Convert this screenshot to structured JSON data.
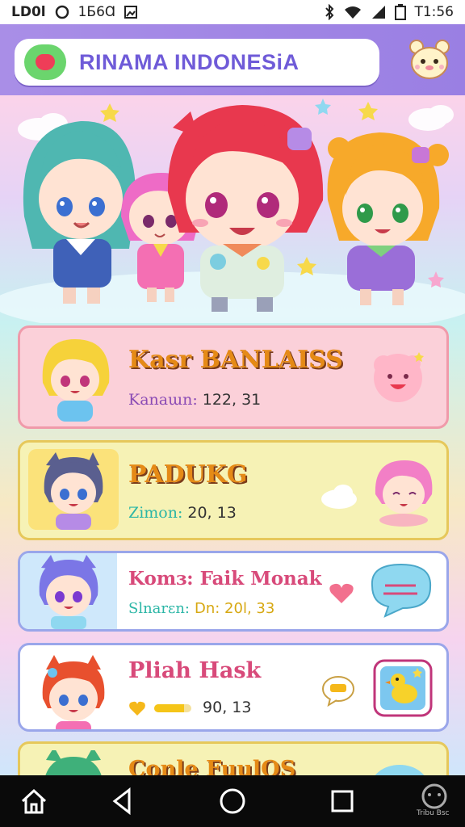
{
  "status_bar": {
    "left_text": "LD0l",
    "left_text_2": "1Ƃ6Ɑ",
    "time": "T1:56",
    "icons": [
      "circle-indicator-icon",
      "image-notification-icon",
      "bluetooth-icon",
      "wifi-icon",
      "signal-icon",
      "battery-icon"
    ]
  },
  "header": {
    "title": "RINAMA INDONESiA",
    "logo": "heart-logo-icon",
    "corner_button": "bear-mascot-icon"
  },
  "hero": {
    "illustration": "four-anime-characters",
    "colors": {
      "sky_top": "#fbd3ea",
      "sky_bottom": "#c8f1f1"
    }
  },
  "cards": [
    {
      "title": "Kasr BANLAISS",
      "key": "Kanaɯn:",
      "value": "122, 31",
      "avatar": "blonde-girl-avatar-icon",
      "deco": "smiley-cloud-icon"
    },
    {
      "title": "PADUKG",
      "key": "Zimon:",
      "value": "20, 13",
      "avatar": "cat-ear-boy-avatar-icon",
      "deco": "pink-hair-girl-icon"
    },
    {
      "title": "Komɜ: Faik Monak",
      "key": "Slnarɛn:",
      "value": "Dn:  20l, 33",
      "avatar": "purple-hair-avatar-icon",
      "deco": "speech-bubble-icon"
    },
    {
      "title": "Pliah Hask",
      "value": "90, 13",
      "progress": 0.8,
      "avatar": "red-hair-avatar-icon",
      "deco": "duck-sticker-icon"
    },
    {
      "title": "Conle FuulOS",
      "avatar": "green-hair-avatar-icon"
    }
  ],
  "colors": {
    "header": "#9a7fe3",
    "title_orange": "#e58a16",
    "title_pink": "#d84a7a",
    "teal": "#2bb6a6",
    "purple": "#6f5bd8"
  },
  "nav_bar": {
    "buttons": [
      "home-icon",
      "back-icon",
      "circle-home-icon",
      "recents-icon"
    ],
    "brand": "Tribu Bsc"
  }
}
